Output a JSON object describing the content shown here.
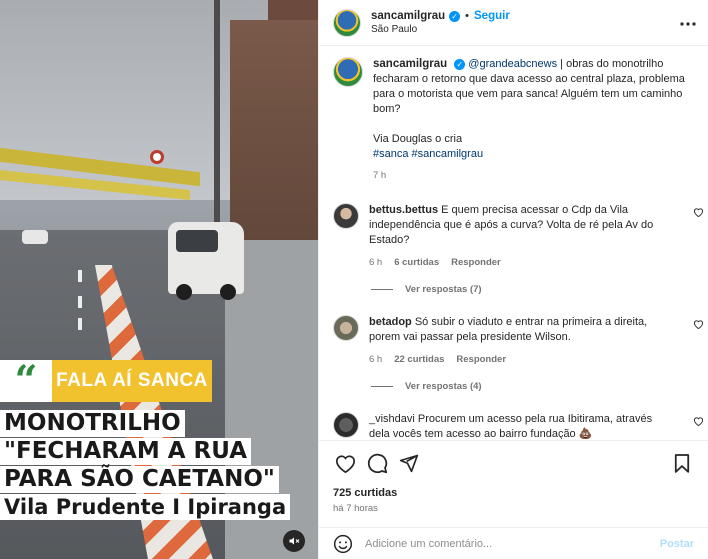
{
  "media": {
    "banner_label": "FALA AÍ SANCA",
    "banner_quote": "“",
    "headline_lines": [
      "MONOTRILHO",
      "\"FECHARAM A RUA",
      "PARA SÃO CAETANO\""
    ],
    "headline_sub": "Vila Prudente I Ipiranga",
    "mute_icon": "muted-speaker-icon"
  },
  "header": {
    "username": "sancamilgrau",
    "follow": "Seguir",
    "separator": "•",
    "location": "São Paulo"
  },
  "caption": {
    "username": "sancamilgrau",
    "mention": "@grandeabcnews",
    "text": " | obras do monotrilho fecharam o retorno que dava acesso ao central plaza, problema para o motorista que vem para sanca! Alguém tem um caminho bom?",
    "credit": "Via Douglas o cria",
    "tags": "#sanca #sancamilgrau",
    "time": "7 h"
  },
  "comments": [
    {
      "username": "bettus.bettus",
      "text": "E quem precisa acessar o Cdp da Vila independência que é após a curva? Volta de ré pela Av do Estado?",
      "time": "6 h",
      "likes": "6 curtidas",
      "reply": "Responder",
      "replies": "Ver respostas (7)"
    },
    {
      "username": "betadop",
      "text": "Só subir o viaduto e entrar na primeira a direita, porem vai passar pela presidente Wilson.",
      "time": "6 h",
      "likes": "22 curtidas",
      "reply": "Responder",
      "replies": "Ver respostas (4)"
    },
    {
      "username": "_vishdavi",
      "text": "Procurem um acesso pela rua Ibitirama, através dela vocês tem acesso ao bairro fundação 💩"
    }
  ],
  "actions": {
    "likes": "725 curtidas",
    "time": "há 7 horas"
  },
  "add_comment": {
    "placeholder": "Adicione um comentário...",
    "post": "Postar"
  },
  "colors": {
    "accent": "#0095f6",
    "mention": "#00376b",
    "banner_yellow": "#f2c12e",
    "quote_green": "#2e8b3e"
  }
}
